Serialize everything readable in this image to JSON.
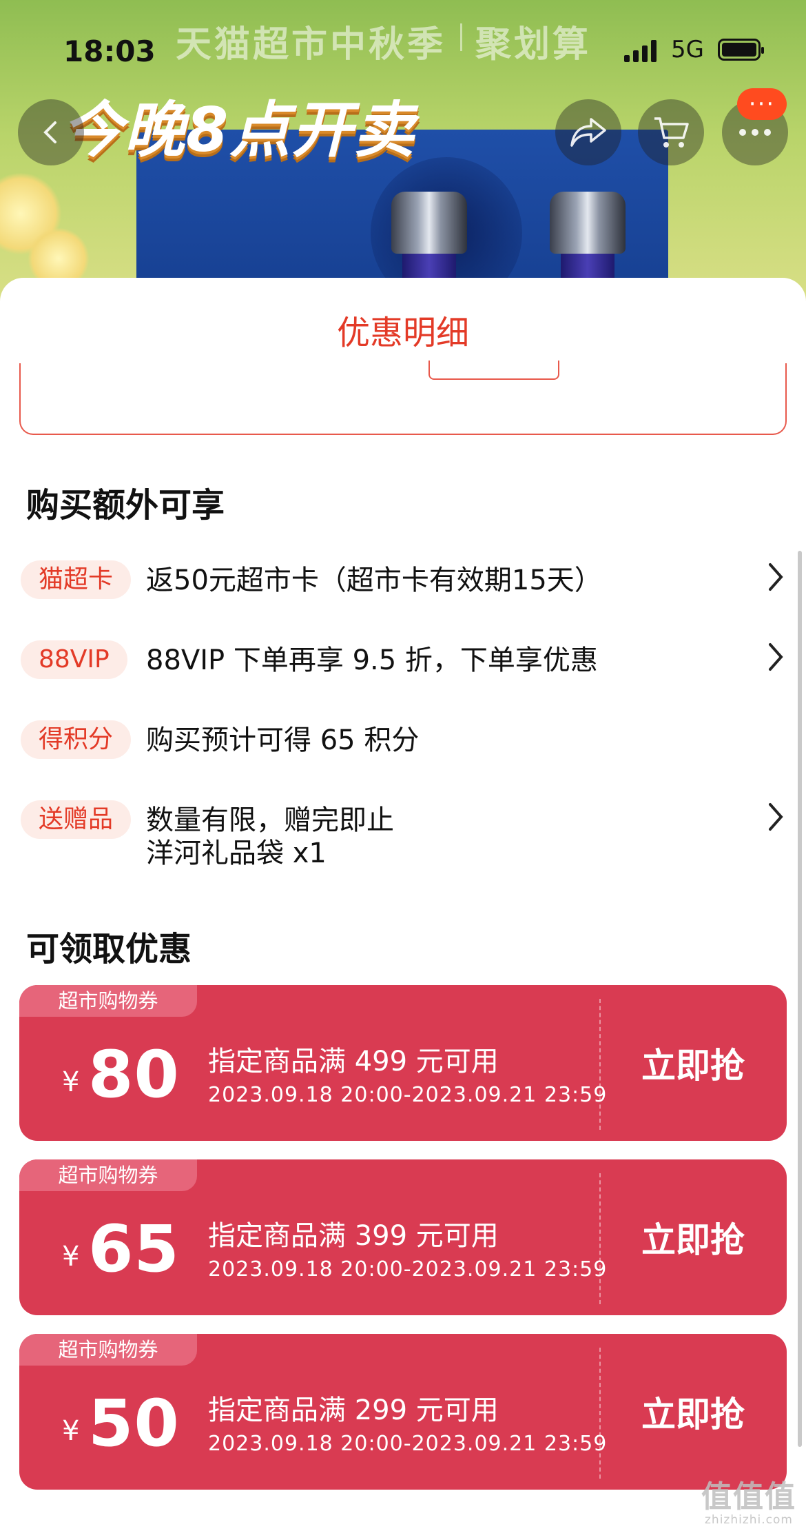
{
  "status_bar": {
    "time": "18:03",
    "network": "5G"
  },
  "banner": {
    "title": "天猫超市中秋季",
    "brand": "聚划算",
    "slogan": "今晚8点开卖",
    "more_badge": "···"
  },
  "sheet": {
    "title": "优惠明细",
    "extra_section_title": "购买额外可享",
    "benefits": [
      {
        "tag": "猫超卡",
        "text": "返50元超市卡（超市卡有效期15天）",
        "arrow": true
      },
      {
        "tag": "88VIP",
        "text": "88VIP 下单再享 9.5 折，下单享优惠",
        "arrow": true
      },
      {
        "tag": "得积分",
        "text": "购买预计可得 65 积分",
        "arrow": false
      },
      {
        "tag": "送赠品",
        "text": "数量有限，赠完即止",
        "text2": "洋河礼品袋 x1",
        "arrow": true
      }
    ],
    "coupon_section_title": "可领取优惠",
    "coupons": [
      {
        "ribbon": "超市购物券",
        "currency": "¥",
        "amount": "80",
        "condition": "指定商品满 499 元可用",
        "period": "2023.09.18 20:00-2023.09.21 23:59",
        "action": "立即抢"
      },
      {
        "ribbon": "超市购物券",
        "currency": "¥",
        "amount": "65",
        "condition": "指定商品满 399 元可用",
        "period": "2023.09.18 20:00-2023.09.21 23:59",
        "action": "立即抢"
      },
      {
        "ribbon": "超市购物券",
        "currency": "¥",
        "amount": "50",
        "condition": "指定商品满 299 元可用",
        "period": "2023.09.18 20:00-2023.09.21 23:59",
        "action": "立即抢"
      }
    ]
  },
  "watermark": {
    "main": "值值值",
    "sub": "zhizhizhi.com"
  }
}
